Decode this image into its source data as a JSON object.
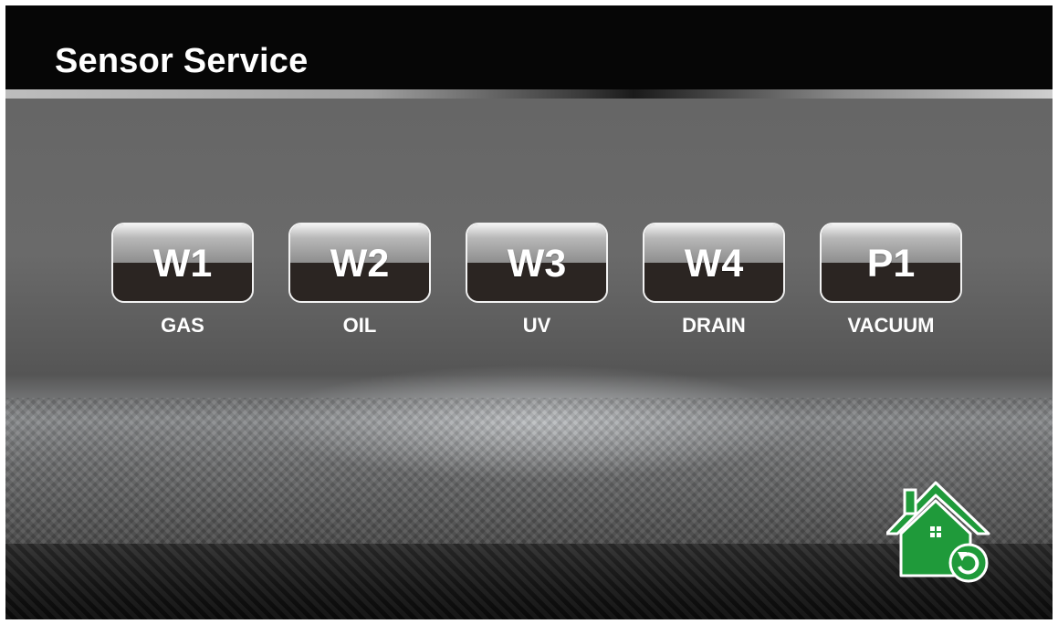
{
  "header": {
    "title": "Sensor Service"
  },
  "sensors": [
    {
      "code": "W1",
      "label": "GAS"
    },
    {
      "code": "W2",
      "label": "OIL"
    },
    {
      "code": "W3",
      "label": "UV"
    },
    {
      "code": "W4",
      "label": "DRAIN"
    },
    {
      "code": "P1",
      "label": "VACUUM"
    }
  ],
  "home_button": {
    "icon": "home-refresh-icon",
    "color": "#1f9a3a"
  }
}
